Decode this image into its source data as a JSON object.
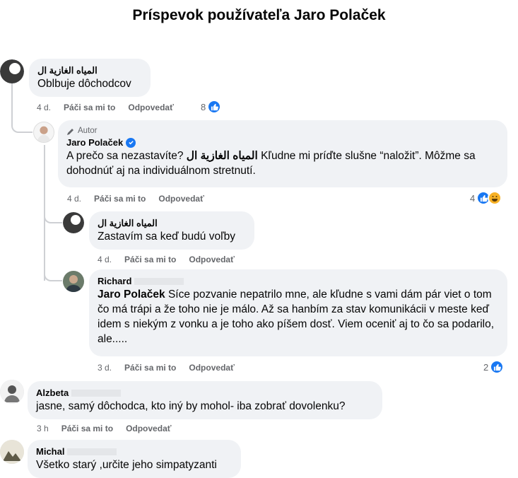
{
  "page": {
    "title": "Príspevok používateľa Jaro Polaček"
  },
  "actions": {
    "like": "Páči sa mi to",
    "reply": "Odpovedať"
  },
  "comments": [
    {
      "author": "المياه الغازية ال",
      "text": "Oblbuje dôchodcov",
      "time": "4 d.",
      "reactions": "8"
    },
    {
      "badge": "Autor",
      "author": "Jaro Polaček",
      "mention": "المياه الغازية ال",
      "text_before": "A prečo sa nezastavíte?",
      "text_after": "Kľudne mi príďte slušne “naložit”. Môžme sa dohodnúť aj na individuálnom stretnutí.",
      "time": "4 d.",
      "reactions": "4"
    },
    {
      "author": "المياه الغازية ال",
      "text": "Zastavím sa keď budú voľby",
      "time": "4 d."
    },
    {
      "author": "Richard",
      "mention": "Jaro Polaček",
      "text": "Síce pozvanie nepatrilo mne, ale kľudne s vami dám pár viet o tom čo má trápi a že toho nie je málo. Až sa hanbím za stav komunikácii v meste keď idem s niekým z vonku a je toho ako píšem dosť. Viem oceniť aj to čo sa podarilo, ale.....",
      "time": "3 d.",
      "reactions": "2"
    },
    {
      "author": "Alzbeta",
      "text": "jasne, samý dôchodca, kto iný by mohol- iba zobrať dovolenku?",
      "time": "3 h"
    },
    {
      "author": "Michal",
      "text": "Všetko starý ,určite jeho simpatyzanti"
    }
  ],
  "colors": {
    "like": "#1877f2",
    "haha": "#f7b125",
    "bubble": "#f0f2f5",
    "meta": "#65676b"
  }
}
